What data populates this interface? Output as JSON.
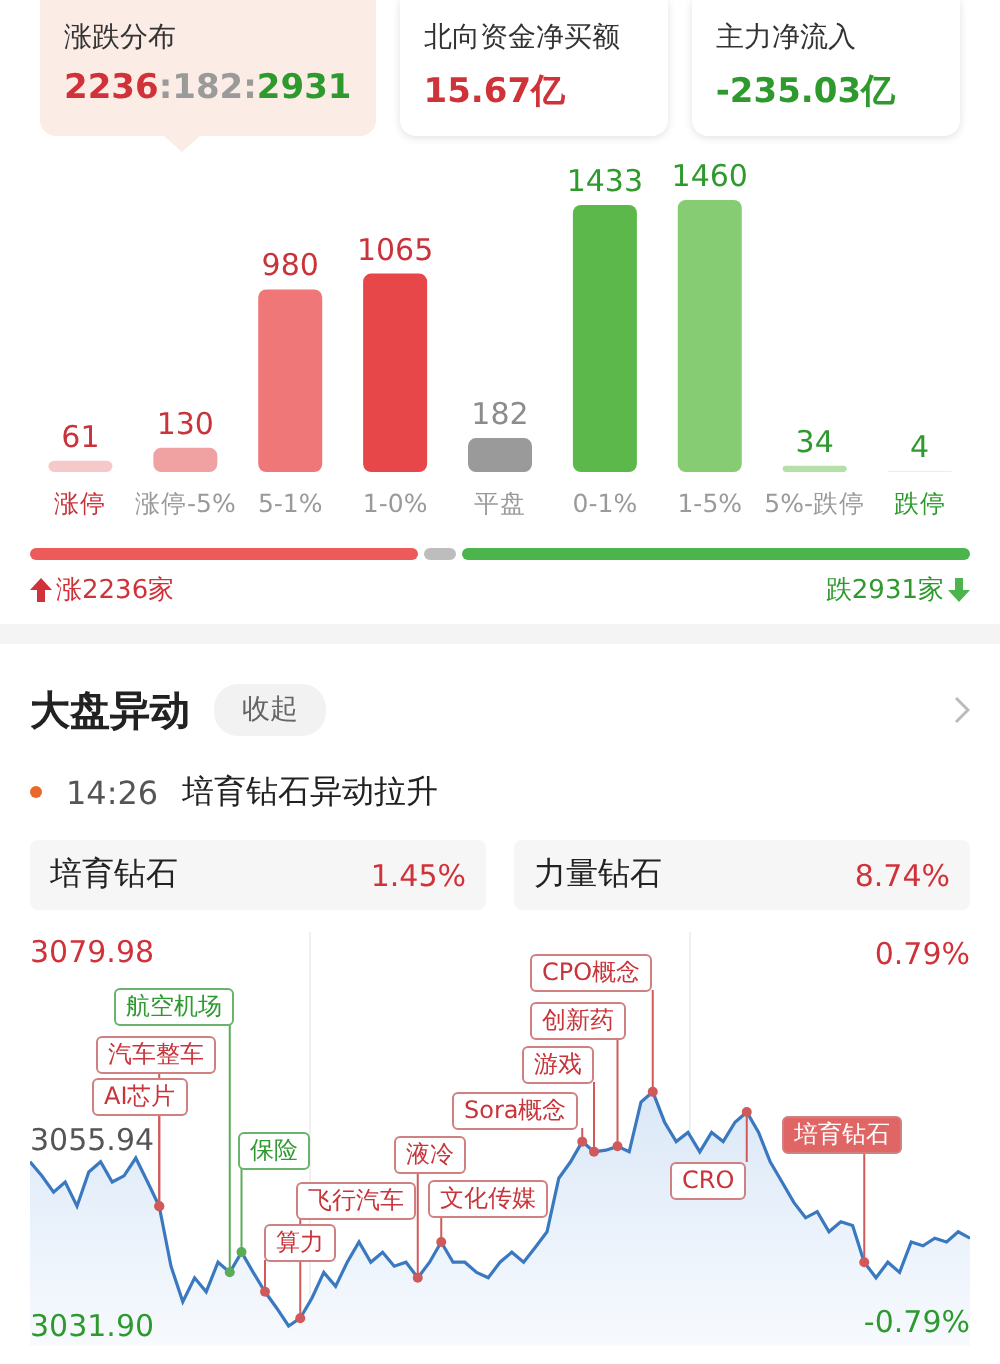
{
  "summary_cards": [
    {
      "title": "涨跌分布",
      "selected": true,
      "value_parts": [
        {
          "text": "2236",
          "color": "#d0323a"
        },
        {
          "text": ":182:",
          "color": "#9a9a9a"
        },
        {
          "text": "2931",
          "color": "#2e9a2e"
        }
      ]
    },
    {
      "title": "北向资金净买额",
      "selected": false,
      "value_parts": [
        {
          "text": "15.67亿",
          "color": "#d0323a"
        }
      ]
    },
    {
      "title": "主力净流入",
      "selected": false,
      "value_parts": [
        {
          "text": "-235.03亿",
          "color": "#2e9a2e"
        }
      ]
    }
  ],
  "distribution": {
    "chart_data": {
      "type": "bar",
      "categories": [
        "涨停",
        "涨停-5%",
        "5-1%",
        "1-0%",
        "平盘",
        "0-1%",
        "1-5%",
        "5%-跌停",
        "跌停"
      ],
      "values": [
        61,
        130,
        980,
        1065,
        182,
        1433,
        1460,
        34,
        4
      ],
      "data_labels": true
    },
    "rise_label": "涨2236家",
    "fall_label": "跌2931家"
  },
  "section": {
    "title": "大盘异动",
    "toggle": "收起",
    "event": {
      "time": "14:26",
      "text": "培育钻石异动拉升"
    },
    "stocks": [
      {
        "name": "培育钻石",
        "change": "1.45%"
      },
      {
        "name": "力量钻石",
        "change": "8.74%"
      }
    ]
  },
  "intraday": {
    "chart_data": {
      "type": "line",
      "ylim": [
        3031.9,
        3079.98
      ],
      "yticks": [
        {
          "value": 3079.98,
          "label": "3079.98"
        },
        {
          "value": 3055.94,
          "label": "3055.94"
        },
        {
          "value": 3031.9,
          "label": "3031.90"
        }
      ],
      "series": [
        {
          "color": "#3a78c0",
          "values": [
            3053.0,
            3051.2,
            3049.1,
            3050.4,
            3047.3,
            3051.7,
            3053.0,
            3050.4,
            3051.2,
            3053.5,
            3050.4,
            3047.3,
            3039.6,
            3035.0,
            3038.1,
            3036.3,
            3040.1,
            3038.8,
            3041.4,
            3038.8,
            3036.3,
            3034.2,
            3031.9,
            3032.9,
            3035.5,
            3038.8,
            3037.0,
            3040.1,
            3042.7,
            3040.1,
            3041.4,
            3039.6,
            3040.1,
            3038.1,
            3040.1,
            3042.7,
            3040.1,
            3040.1,
            3038.8,
            3038.1,
            3040.1,
            3041.4,
            3040.1,
            3042.0,
            3044.0,
            3050.9,
            3053.0,
            3055.6,
            3054.3,
            3054.5,
            3055.0,
            3054.3,
            3060.7,
            3062.0,
            3058.1,
            3055.6,
            3056.8,
            3054.3,
            3056.8,
            3055.6,
            3058.1,
            3059.4,
            3056.8,
            3053.0,
            3050.4,
            3047.8,
            3045.8,
            3046.6,
            3044.0,
            3045.3,
            3044.8,
            3040.1,
            3038.1,
            3040.1,
            3038.8,
            3042.7,
            3042.2,
            3043.2,
            3042.7,
            3044.0,
            3043.2
          ]
        }
      ]
    },
    "right_axis_labels": [
      "0.79%",
      "-0.79%"
    ],
    "annotations": [
      {
        "text": "航空机场",
        "kind": "fall"
      },
      {
        "text": "汽车整车",
        "kind": "rise"
      },
      {
        "text": "AI芯片",
        "kind": "rise"
      },
      {
        "text": "保险",
        "kind": "fall"
      },
      {
        "text": "算力",
        "kind": "rise"
      },
      {
        "text": "飞行汽车",
        "kind": "rise"
      },
      {
        "text": "液冷",
        "kind": "rise"
      },
      {
        "text": "文化传媒",
        "kind": "rise"
      },
      {
        "text": "游戏",
        "kind": "rise"
      },
      {
        "text": "Sora概念",
        "kind": "rise"
      },
      {
        "text": "CPO概念",
        "kind": "rise"
      },
      {
        "text": "创新药",
        "kind": "rise"
      },
      {
        "text": "CRO",
        "kind": "rise"
      },
      {
        "text": "培育钻石",
        "kind": "highlight"
      }
    ]
  }
}
